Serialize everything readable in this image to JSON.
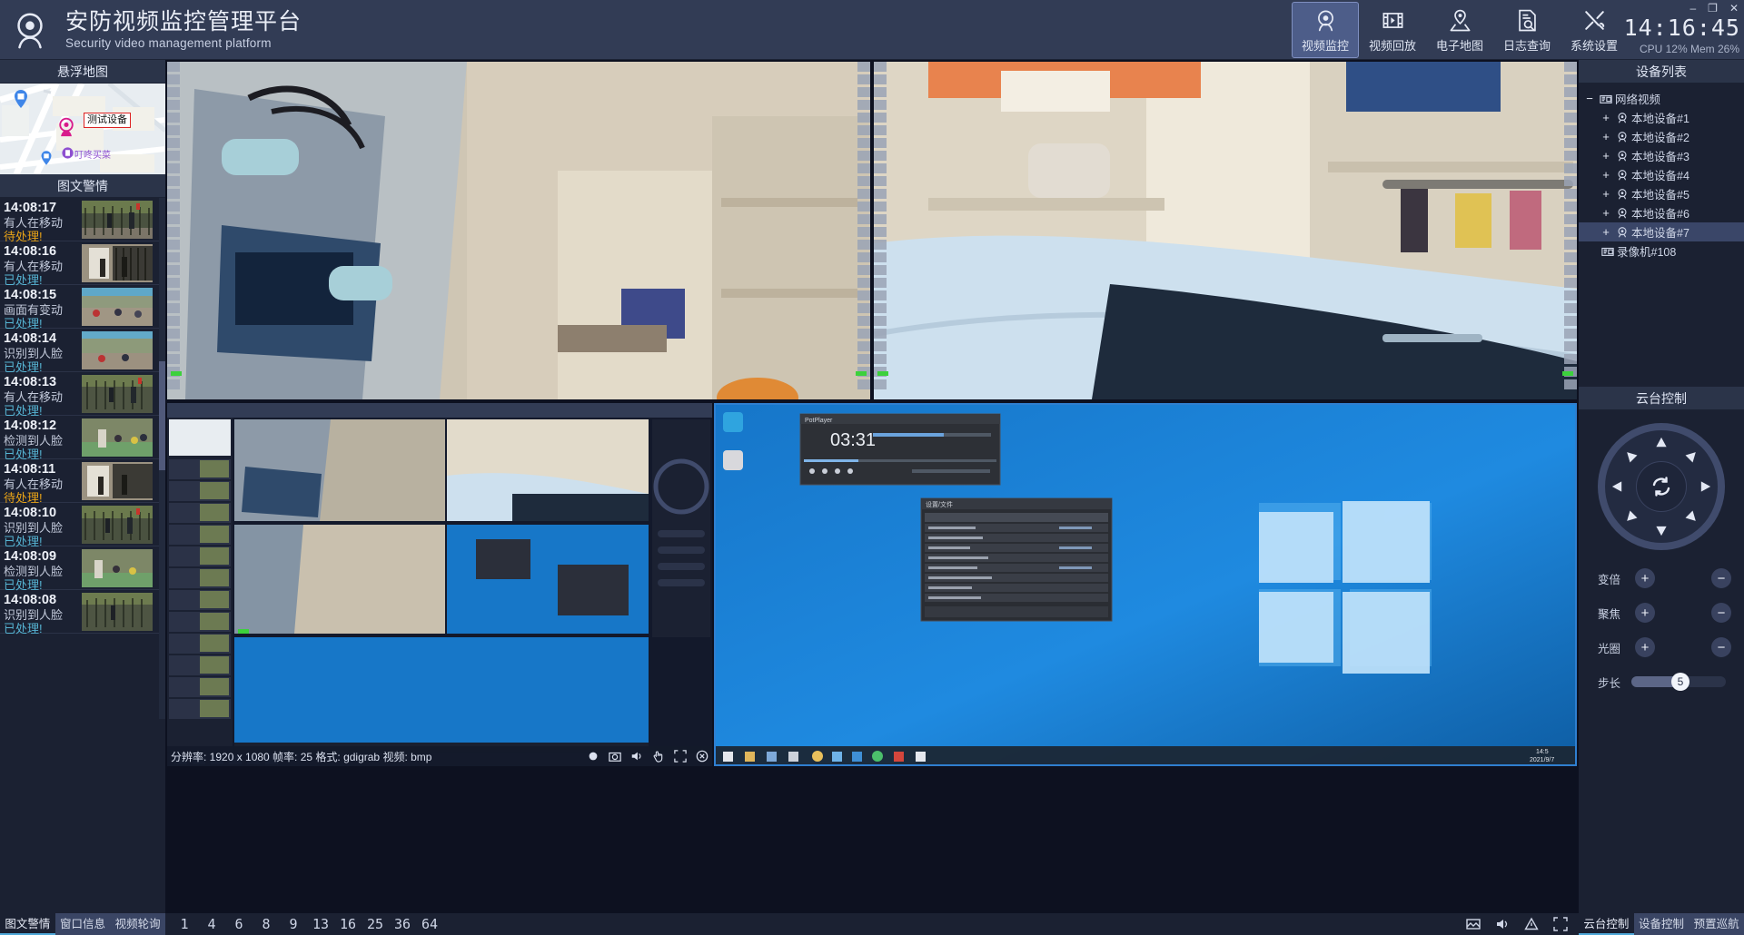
{
  "header": {
    "title_cn": "安防视频监控管理平台",
    "title_en": "Security video management platform",
    "logo_icon": "camera-dome-icon",
    "nav": [
      {
        "label": "视频监控",
        "icon": "camera-dome-icon",
        "active": true
      },
      {
        "label": "视频回放",
        "icon": "film-play-icon",
        "active": false
      },
      {
        "label": "电子地图",
        "icon": "map-pin-icon",
        "active": false
      },
      {
        "label": "日志查询",
        "icon": "document-search-icon",
        "active": false
      },
      {
        "label": "系统设置",
        "icon": "tools-icon",
        "active": false
      }
    ],
    "window_controls": {
      "minimize": "–",
      "maximize": "❐",
      "close": "✕"
    },
    "clock": "14:16:45",
    "usage": "CPU 12%  Mem 26%"
  },
  "left_panel": {
    "map_title": "悬浮地图",
    "map_marker_label": "测试设备",
    "map_poi_label": "叮咚买菜",
    "alarm_title": "图文警情",
    "alarms": [
      {
        "time": "14:08:17",
        "desc": "有人在移动",
        "state": "待处理!",
        "state_type": "pending"
      },
      {
        "time": "14:08:16",
        "desc": "有人在移动",
        "state": "已处理!",
        "state_type": "done"
      },
      {
        "time": "14:08:15",
        "desc": "画面有变动",
        "state": "已处理!",
        "state_type": "done"
      },
      {
        "time": "14:08:14",
        "desc": "识别到人脸",
        "state": "已处理!",
        "state_type": "done"
      },
      {
        "time": "14:08:13",
        "desc": "有人在移动",
        "state": "已处理!",
        "state_type": "done"
      },
      {
        "time": "14:08:12",
        "desc": "检测到人脸",
        "state": "已处理!",
        "state_type": "done"
      },
      {
        "time": "14:08:11",
        "desc": "有人在移动",
        "state": "待处理!",
        "state_type": "pending"
      },
      {
        "time": "14:08:10",
        "desc": "识别到人脸",
        "state": "已处理!",
        "state_type": "done"
      },
      {
        "time": "14:08:09",
        "desc": "检测到人脸",
        "state": "已处理!",
        "state_type": "done"
      },
      {
        "time": "14:08:08",
        "desc": "识别到人脸",
        "state": "已处理!",
        "state_type": "done"
      }
    ],
    "tabs": [
      {
        "label": "图文警情",
        "active": true
      },
      {
        "label": "窗口信息",
        "active": false
      },
      {
        "label": "视频轮询",
        "active": false
      }
    ]
  },
  "right_panel": {
    "device_title": "设备列表",
    "devices": [
      {
        "label": "网络视频",
        "level": 1,
        "indicator": "−",
        "icon": "nvr-icon",
        "selected": false
      },
      {
        "label": "本地设备#1",
        "level": 2,
        "indicator": "+",
        "icon": "camera-dome-icon",
        "selected": false
      },
      {
        "label": "本地设备#2",
        "level": 2,
        "indicator": "+",
        "icon": "camera-dome-icon",
        "selected": false
      },
      {
        "label": "本地设备#3",
        "level": 2,
        "indicator": "+",
        "icon": "camera-dome-icon",
        "selected": false
      },
      {
        "label": "本地设备#4",
        "level": 2,
        "indicator": "+",
        "icon": "camera-dome-icon",
        "selected": false
      },
      {
        "label": "本地设备#5",
        "level": 2,
        "indicator": "+",
        "icon": "camera-dome-icon",
        "selected": false
      },
      {
        "label": "本地设备#6",
        "level": 2,
        "indicator": "+",
        "icon": "camera-dome-icon",
        "selected": false
      },
      {
        "label": "本地设备#7",
        "level": 2,
        "indicator": "+",
        "icon": "camera-dome-icon",
        "selected": true
      },
      {
        "label": "录像机#108",
        "level": 1,
        "indicator": "",
        "icon": "nvr-icon",
        "selected": false
      }
    ],
    "ptz_title": "云台控制",
    "ptz_center_icon": "auto-rotate-icon",
    "ptz_rows": [
      {
        "label": "变倍",
        "plus": "+",
        "minus": "−"
      },
      {
        "label": "聚焦",
        "plus": "+",
        "minus": "−"
      },
      {
        "label": "光圈",
        "plus": "+",
        "minus": "−"
      }
    ],
    "step_label": "步长",
    "step_value": "5",
    "tabs": [
      {
        "label": "云台控制",
        "active": true
      },
      {
        "label": "设备控制",
        "active": false
      },
      {
        "label": "预置巡航",
        "active": false
      }
    ]
  },
  "center": {
    "video_info": "分辨率: 1920 x 1080  帧率: 25  格式: gdigrab  视频: bmp",
    "video_info_icons": [
      "record-icon",
      "snapshot-icon",
      "volume-icon",
      "hand-icon",
      "fullscreen-icon",
      "close-icon"
    ],
    "layout_buttons": [
      "1",
      "4",
      "6",
      "8",
      "9",
      "13",
      "16",
      "25",
      "36",
      "64"
    ],
    "bottom_icons": [
      "image-icon",
      "volume-icon",
      "alert-icon",
      "fullscreen-icon"
    ],
    "cells": [
      {
        "name": "cell-top-left",
        "selected": false
      },
      {
        "name": "cell-top-right",
        "selected": false
      },
      {
        "name": "cell-bottom-left",
        "selected": false
      },
      {
        "name": "cell-bottom-right",
        "selected": true
      }
    ]
  },
  "colors": {
    "header_bg": "#323c55",
    "panel_bg": "#1b2132",
    "panel_title_bg": "#2b3449",
    "accent": "#4fa8d8",
    "nav_active": "#4d5d89",
    "state_pending": "#e8a317",
    "state_done": "#56b4d3",
    "selection": "#3a4668",
    "status_led": "#3cd13c"
  }
}
